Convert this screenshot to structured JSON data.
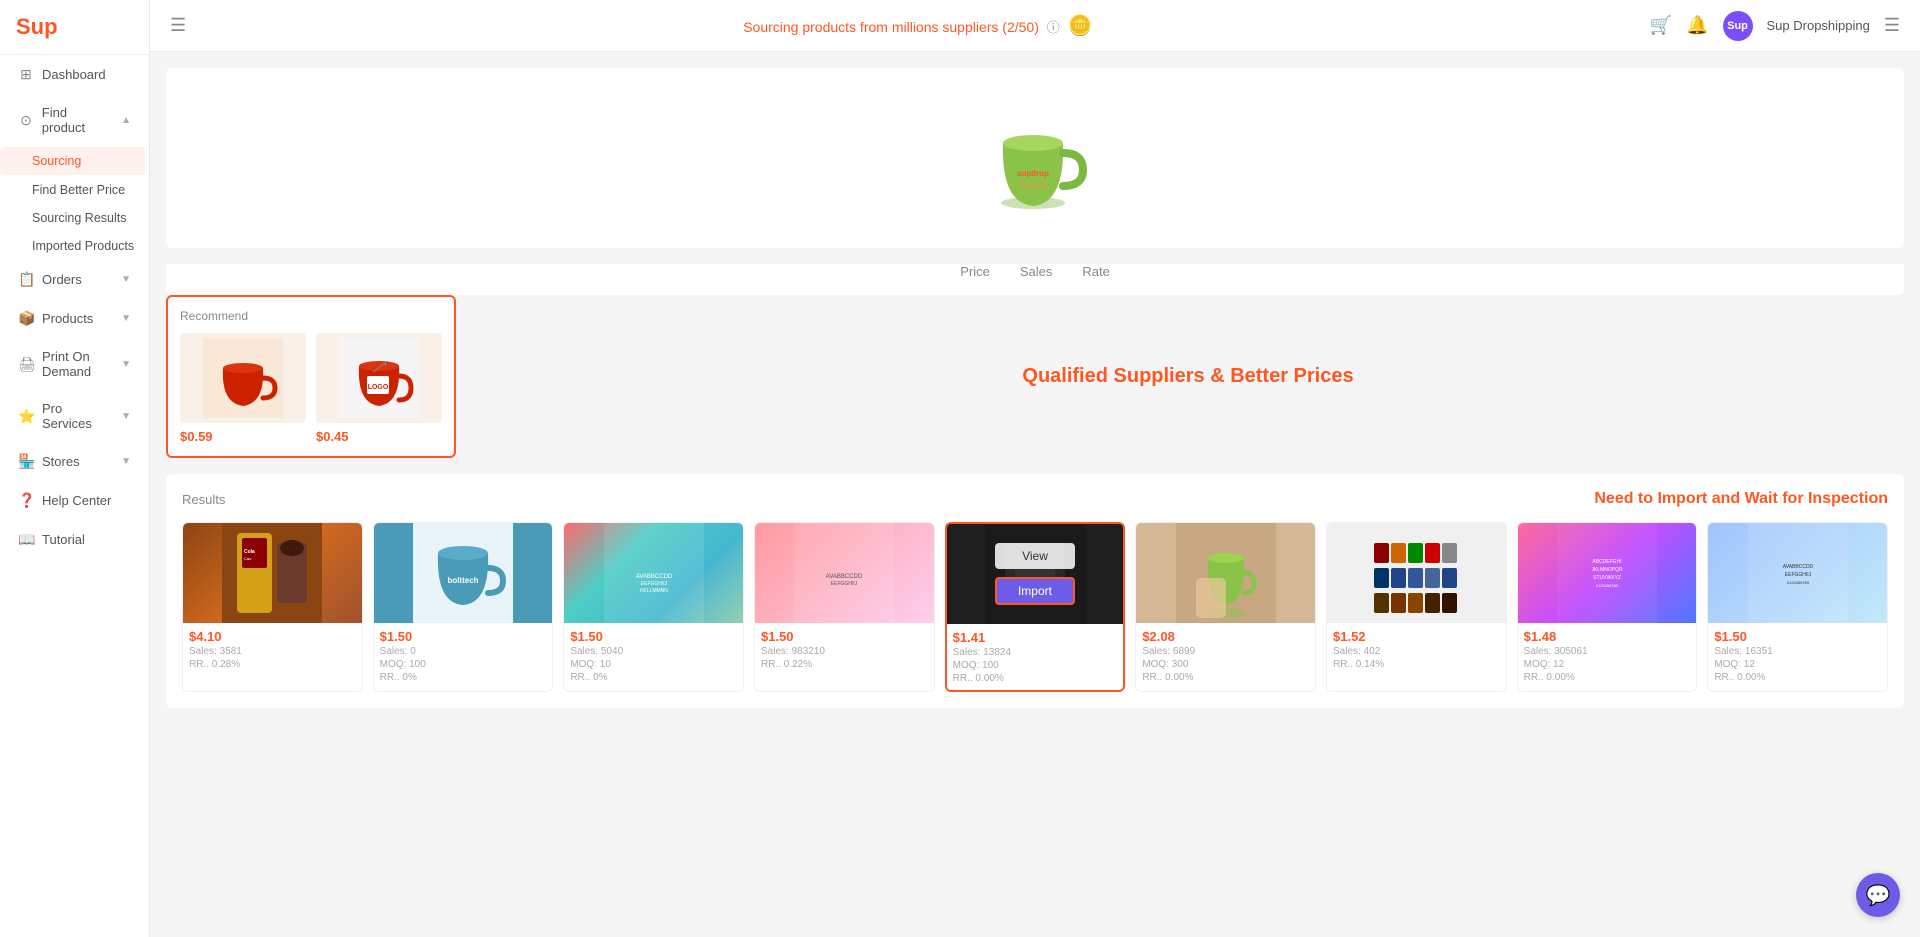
{
  "app": {
    "logo": "Sup",
    "menu_icon": "☰"
  },
  "topbar": {
    "sourcing_text": "Sourcing products from millions suppliers (2/50)",
    "help_icon": "?",
    "cart_icon": "🛒",
    "bell_icon": "🔔",
    "user_label": "Sup Dropshipping",
    "menu_icon": "☰"
  },
  "sidebar": {
    "logo": "Sup",
    "items": [
      {
        "id": "dashboard",
        "label": "Dashboard",
        "icon": "⊞"
      },
      {
        "id": "find-product",
        "label": "Find product",
        "icon": "⊙",
        "expanded": true
      },
      {
        "id": "sourcing",
        "label": "Sourcing",
        "sub": true,
        "active": true
      },
      {
        "id": "find-better-price",
        "label": "Find Better Price",
        "sub": true
      },
      {
        "id": "sourcing-results",
        "label": "Sourcing Results",
        "sub": true
      },
      {
        "id": "imported-products",
        "label": "Imported Products",
        "sub": true
      },
      {
        "id": "orders",
        "label": "Orders",
        "icon": "📋",
        "expanded": false
      },
      {
        "id": "products",
        "label": "Products",
        "icon": "📦",
        "expanded": false
      },
      {
        "id": "print-on-demand",
        "label": "Print On Demand",
        "icon": "🖨",
        "expanded": false
      },
      {
        "id": "pro-services",
        "label": "Pro Services",
        "icon": "⭐",
        "expanded": false
      },
      {
        "id": "stores",
        "label": "Stores",
        "icon": "🏪",
        "expanded": false
      },
      {
        "id": "help-center",
        "label": "Help Center",
        "icon": "❓"
      },
      {
        "id": "tutorial",
        "label": "Tutorial",
        "icon": "📖"
      }
    ]
  },
  "filter_tabs": [
    "Price",
    "Sales",
    "Rate"
  ],
  "recommend": {
    "label": "Recommend",
    "products": [
      {
        "price": "$0.59"
      },
      {
        "price": "$0.45"
      }
    ]
  },
  "cta": {
    "text": "Qualified Suppliers & Better Prices"
  },
  "results": {
    "label": "Results",
    "need_import_text": "Need to Import and Wait for Inspection",
    "products": [
      {
        "price": "$4.10",
        "sales": "Sales: 3581",
        "rr": "RR.. 0.28%",
        "img_class": "img-colacao"
      },
      {
        "price": "$1.50",
        "sales": "Sales: 0",
        "moq": "MOQ: 100",
        "rr": "RR.. 0%",
        "img_class": "img-blue-mug"
      },
      {
        "price": "$1.50",
        "sales": "Sales: 5040",
        "moq": "MOQ: 10",
        "rr": "RR.. 0%",
        "img_class": "img-stickers"
      },
      {
        "price": "$1.50",
        "sales": "Sales: 983210",
        "moq": "",
        "rr": "RR.. 0.22%",
        "img_class": "img-stickers"
      },
      {
        "price": "$1.41",
        "sales": "Sales: 13824",
        "moq": "MOQ: 100",
        "rr": "RR.. 0.00%",
        "img_class": "img-dark",
        "highlighted": true,
        "show_overlay": true
      },
      {
        "price": "$2.08",
        "sales": "Sales: 6899",
        "moq": "MOQ: 300",
        "rr": "RR.. 0.00%",
        "img_class": "img-green-mug"
      },
      {
        "price": "$1.52",
        "sales": "Sales: 402",
        "moq": "",
        "rr": "RR.. 0.14%",
        "img_class": "img-multi-mugs"
      },
      {
        "price": "$1.48",
        "sales": "Sales: 305061",
        "moq": "MOQ: 12",
        "rr": "RR.. 0.00%",
        "img_class": "img-stickers2"
      },
      {
        "price": "$1.50",
        "sales": "Sales: 16351",
        "moq": "MOQ: 12",
        "rr": "RR.. 0.00%",
        "img_class": "img-stickers3"
      }
    ],
    "overlay_view": "View",
    "overlay_import": "Import"
  }
}
